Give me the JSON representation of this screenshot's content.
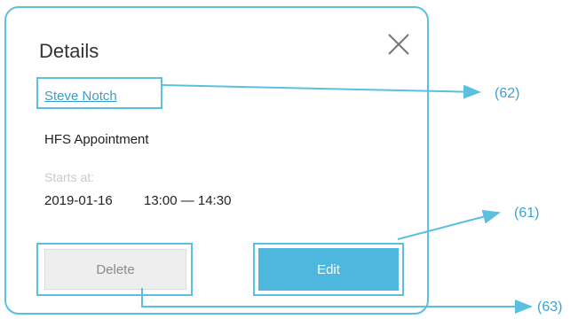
{
  "dialog": {
    "title": "Details",
    "close_icon": "close-icon",
    "patient_name": "Steve Notch",
    "appointment_type": "HFS Appointment",
    "starts_label": "Starts at:",
    "start_date": "2019-01-16",
    "time_range": "13:00 — 14:30",
    "delete_label": "Delete",
    "edit_label": "Edit"
  },
  "callouts": {
    "patient_link": "(62)",
    "edit_button": "(61)",
    "delete_button": "(63)"
  },
  "colors": {
    "accent": "#5bbfe0",
    "edit_button": "#4db7de",
    "link": "#3a9ed0",
    "callout": "#3aa3d6"
  }
}
